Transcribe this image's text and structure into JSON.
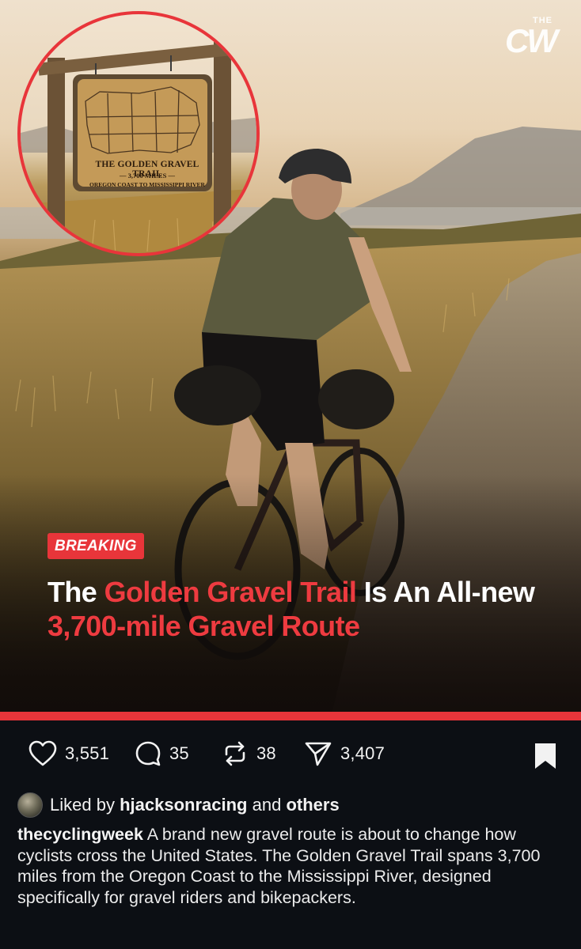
{
  "media": {
    "brand": {
      "small": "THE",
      "large": "CW"
    },
    "inset_sign": {
      "title": "THE GOLDEN GRAVEL TRAIL",
      "miles": "— 3,700 MILES —",
      "route": "OREGON COAST TO MISSISSIPPI RIVER"
    },
    "badge": "BREAKING",
    "headline": {
      "part1": "The ",
      "highlight1": "Golden Gravel Trail",
      "part2": " Is An All-new ",
      "highlight2": "3,700-mile Gravel Route",
      "part3": ""
    },
    "accent_color": "#e8353a"
  },
  "actions": {
    "likes": "3,551",
    "comments": "35",
    "reposts": "38",
    "shares": "3,407"
  },
  "likes_row": {
    "prefix": "Liked by",
    "user": "hjacksonracing",
    "connector": "and",
    "others": "others"
  },
  "caption": {
    "username": "thecyclingweek",
    "text": "A brand new gravel route is about to change how cyclists cross the United States. The Golden Gravel Trail spans 3,700 miles from the Oregon Coast to the Mississippi River, designed specifically for gravel riders and bikepackers."
  }
}
